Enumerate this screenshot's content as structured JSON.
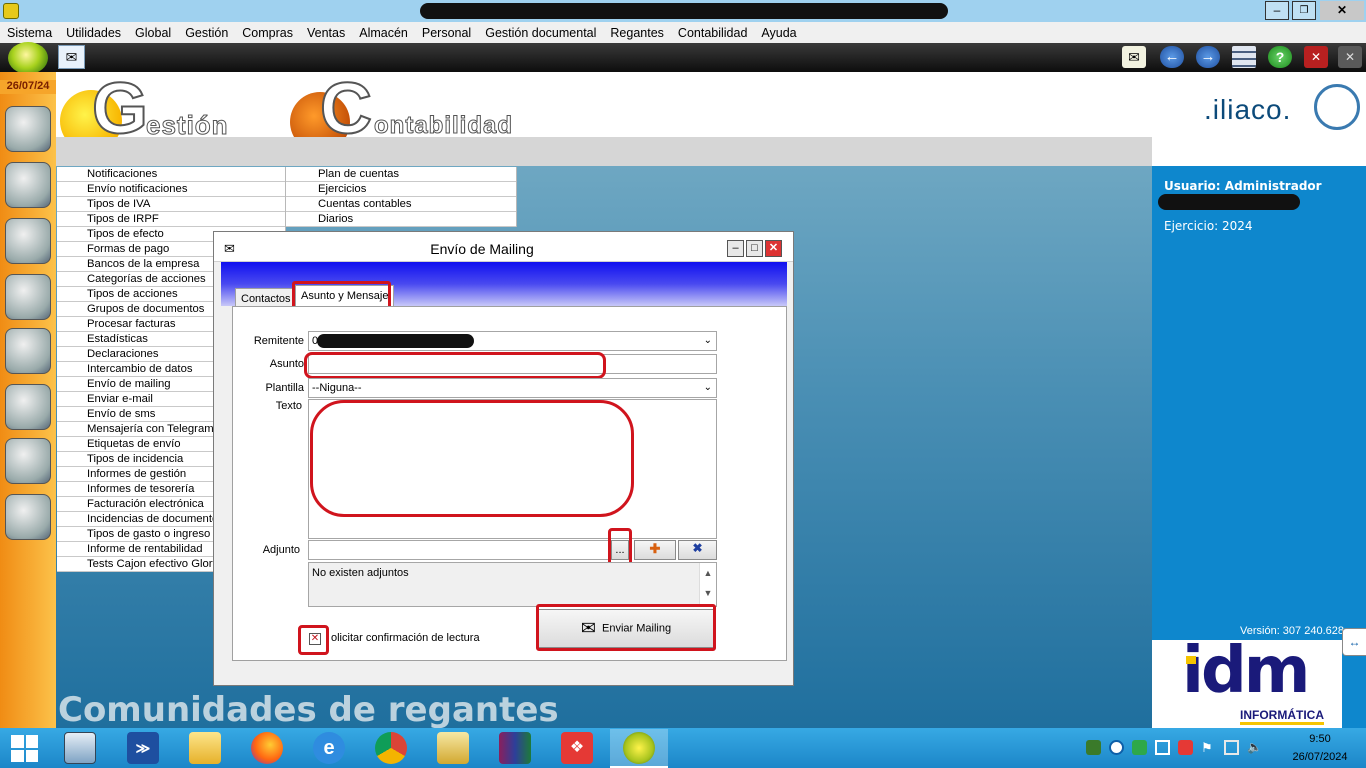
{
  "menu": [
    "Sistema",
    "Utilidades",
    "Global",
    "Gestión",
    "Compras",
    "Ventas",
    "Almacén",
    "Personal",
    "Gestión documental",
    "Regantes",
    "Contabilidad",
    "Ayuda"
  ],
  "left_date": "26/07/24",
  "header": {
    "gestion_logo": "estión",
    "gestion_letter": "G",
    "contab_logo": "ontabilidad",
    "contab_letter": "C",
    "brand": ".iliaco."
  },
  "left_menu": [
    "Notificaciones",
    "Envío notificaciones",
    "Tipos de IVA",
    "Tipos de IRPF",
    "Tipos de efecto",
    "Formas de pago",
    "Bancos de la empresa",
    "Categorías de acciones",
    "Tipos de acciones",
    "Grupos de documentos",
    "Procesar facturas",
    "Estadísticas",
    "Declaraciones",
    "Intercambio de datos",
    "Envío de mailing",
    "Enviar e-mail",
    "Envío de sms",
    "Mensajería con Telegram",
    "Etiquetas de envío",
    "Tipos de incidencia",
    "Informes de gestión",
    "Informes de tesorería",
    "Facturación electrónica",
    "Incidencias de documentos",
    "Tipos de gasto o ingreso",
    "Informe de rentabilidad",
    "Tests Cajon efectivo Glory"
  ],
  "right_menu": [
    "Plan de cuentas",
    "Ejercicios",
    "Cuentas contables",
    "Diarios"
  ],
  "right_panel": {
    "usuario": "Usuario: Administrador",
    "ejercicio": "Ejercicio: 2024",
    "version": "Versión: 307 240.628",
    "idm": "idm",
    "informatica": "INFORMÁTICA"
  },
  "footer_title": "Comunidades de regantes",
  "dialog": {
    "title": "Envío de Mailing",
    "tabs": [
      "Contactos",
      "Asunto y Mensaje"
    ],
    "labels": {
      "remitente": "Remitente",
      "asunto": "Asunto",
      "plantilla": "Plantilla",
      "texto": "Texto",
      "adjunto": "Adjunto"
    },
    "remitente_value": "0",
    "plantilla_value": "--Niguna--",
    "adjuntos_text": "No existen adjuntos",
    "browse_label": "...",
    "send_button": "Enviar Mailing",
    "confirm_label": "olicitar confirmación de lectura"
  },
  "clock": {
    "time": "9:50",
    "date": "26/07/2024"
  },
  "colors": {
    "accent_red": "#d0141d",
    "taskbar": "#1c86c8",
    "panel_blue": "#0e87cd",
    "leftbar": "#f08c14"
  }
}
